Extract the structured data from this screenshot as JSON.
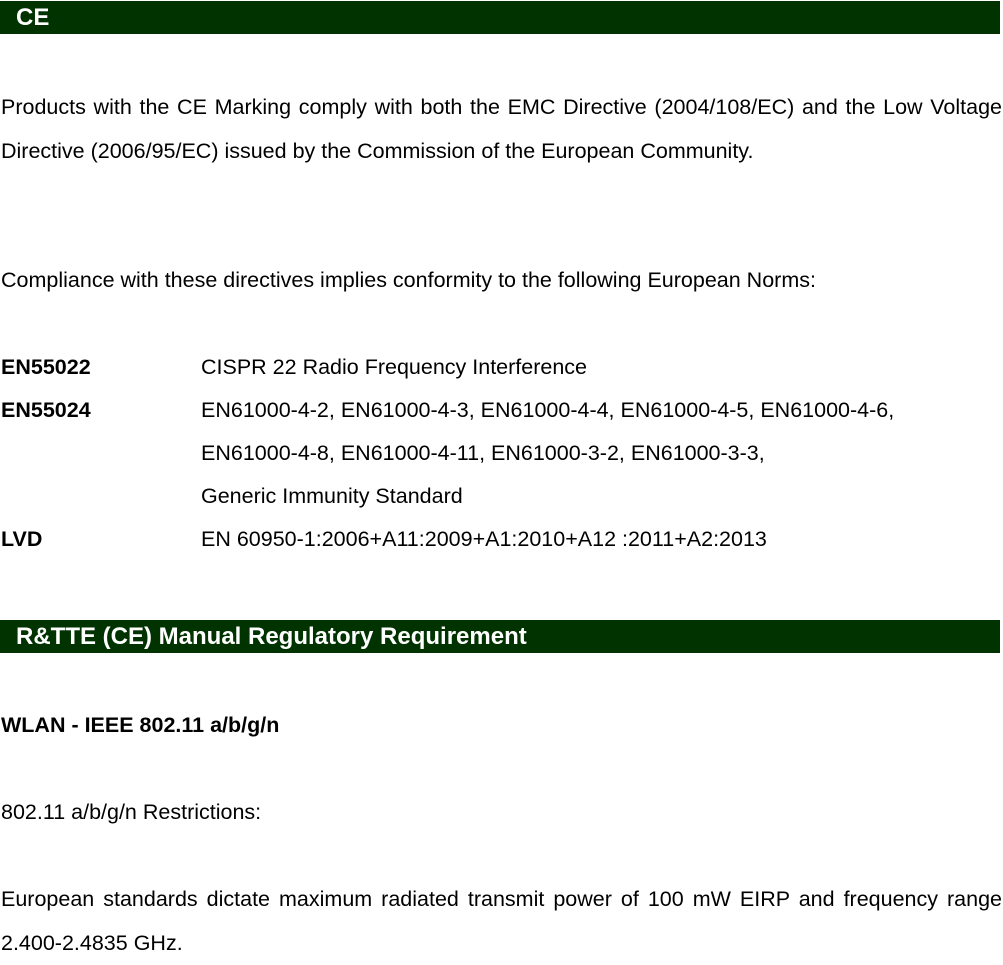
{
  "sections": {
    "ce": {
      "heading": "CE",
      "intro": "Products with the CE Marking comply with both the EMC Directive (2004/108/EC) and the Low Voltage Directive (2006/95/EC) issued by the Commission of the European Community.",
      "compliance": "Compliance with these directives implies conformity to the following European Norms:",
      "norms": [
        {
          "code": "EN55022",
          "lines": [
            "CISPR 22 Radio Frequency Interference"
          ]
        },
        {
          "code": "EN55024",
          "lines": [
            "EN61000-4-2, EN61000-4-3, EN61000-4-4, EN61000-4-5, EN61000-4-6,",
            "EN61000-4-8, EN61000-4-11, EN61000-3-2, EN61000-3-3,",
            "Generic Immunity Standard"
          ]
        },
        {
          "code": "LVD",
          "lines": [
            "EN 60950-1:2006+A11:2009+A1:2010+A12 :2011+A2:2013"
          ]
        }
      ]
    },
    "rtte": {
      "heading": "R&TTE (CE) Manual Regulatory Requirement",
      "wlan_title": "WLAN - IEEE 802.11 a/b/g/n",
      "restrictions": "802.11 a/b/g/n Restrictions:",
      "power": "European standards dictate maximum radiated transmit power of 100 mW EIRP and frequency range 2.400-2.4835 GHz."
    }
  },
  "colors": {
    "banner_bg": "#003300",
    "banner_text": "#ffffff"
  }
}
